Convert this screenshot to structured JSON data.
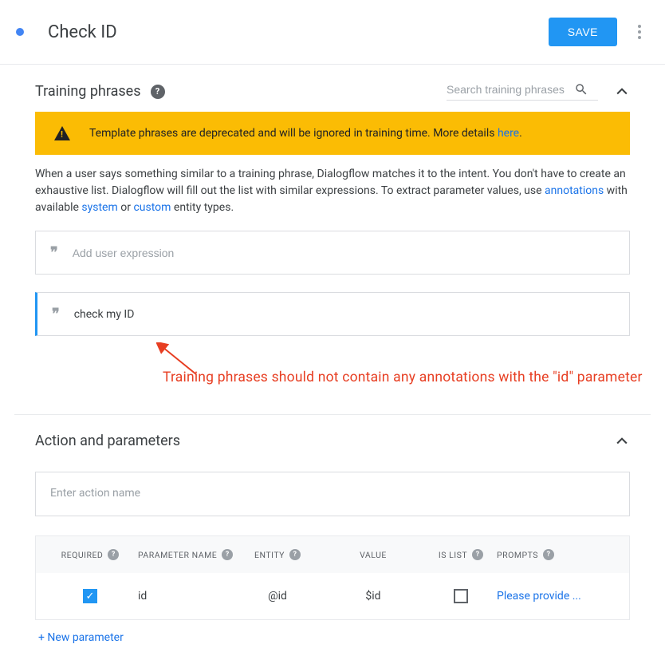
{
  "header": {
    "title": "Check ID",
    "save_label": "SAVE"
  },
  "training": {
    "section_title": "Training phrases",
    "search_placeholder": "Search training phrases",
    "warning_text": "Template phrases are deprecated and will be ignored in training time. More details ",
    "warning_link": "here",
    "desc_pre": "When a user says something similar to a training phrase, Dialogflow matches it to the intent. You don't have to create an exhaustive list. Dialogflow will fill out the list with similar expressions. To extract parameter values, use ",
    "link_annotations": "annotations",
    "desc_mid1": " with available ",
    "link_system": "system",
    "desc_mid2": " or ",
    "link_custom": "custom",
    "desc_post": " entity types.",
    "add_placeholder": "Add user expression",
    "phrase1": "check my ID",
    "annotation": "Training phrases should not contain any annotations with the \"id\" parameter"
  },
  "action": {
    "section_title": "Action and parameters",
    "input_placeholder": "Enter action name",
    "headers": {
      "required": "REQUIRED",
      "param_name": "PARAMETER NAME",
      "entity": "ENTITY",
      "value": "VALUE",
      "is_list": "IS LIST",
      "prompts": "PROMPTS"
    },
    "row": {
      "param_name": "id",
      "entity": "@id",
      "value": "$id",
      "prompt": "Please provide ..."
    },
    "new_param": "+  New parameter"
  }
}
